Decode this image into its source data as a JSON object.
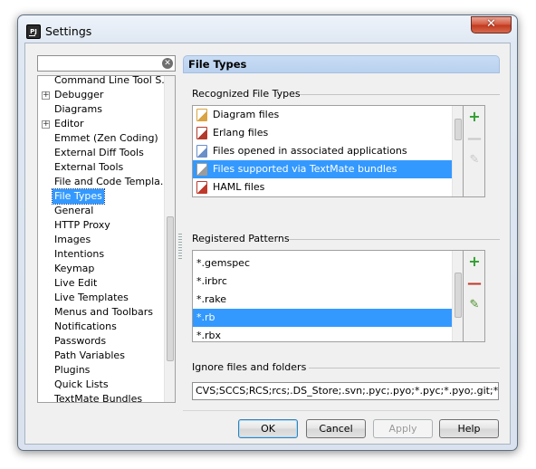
{
  "window": {
    "title": "Settings",
    "app_icon_text": "PJ",
    "close_glyph": "✕"
  },
  "sidebar": {
    "search": {
      "value": "",
      "clear_glyph": "✕"
    },
    "items": [
      {
        "label": "Command Line Tool S...",
        "expandable": false
      },
      {
        "label": "Debugger",
        "expandable": true
      },
      {
        "label": "Diagrams",
        "expandable": false
      },
      {
        "label": "Editor",
        "expandable": true
      },
      {
        "label": "Emmet (Zen Coding)",
        "expandable": false
      },
      {
        "label": "External Diff Tools",
        "expandable": false
      },
      {
        "label": "External Tools",
        "expandable": false
      },
      {
        "label": "File and Code Templa...",
        "expandable": false
      },
      {
        "label": "File Types",
        "expandable": false,
        "selected": true
      },
      {
        "label": "General",
        "expandable": false
      },
      {
        "label": "HTTP Proxy",
        "expandable": false
      },
      {
        "label": "Images",
        "expandable": false
      },
      {
        "label": "Intentions",
        "expandable": false
      },
      {
        "label": "Keymap",
        "expandable": false
      },
      {
        "label": "Live Edit",
        "expandable": false
      },
      {
        "label": "Live Templates",
        "expandable": false
      },
      {
        "label": "Menus and Toolbars",
        "expandable": false
      },
      {
        "label": "Notifications",
        "expandable": false
      },
      {
        "label": "Passwords",
        "expandable": false
      },
      {
        "label": "Path Variables",
        "expandable": false
      },
      {
        "label": "Plugins",
        "expandable": false
      },
      {
        "label": "Quick Lists",
        "expandable": false
      },
      {
        "label": "TextMate Bundles",
        "expandable": false
      }
    ],
    "expander_glyph": "+"
  },
  "main": {
    "header": "File Types",
    "recognized": {
      "label": "Recognized File Types",
      "items": [
        {
          "label": "Diagram files",
          "icon": "diagram-file-icon",
          "icon_color": "#d9a441"
        },
        {
          "label": "Erlang files",
          "icon": "erlang-file-icon",
          "icon_color": "#b33a2d"
        },
        {
          "label": "Files opened in associated applications",
          "icon": "external-file-icon",
          "icon_color": "#6a8fc9"
        },
        {
          "label": "Files supported via TextMate bundles",
          "icon": "textmate-file-icon",
          "icon_color": "#9b9b9b",
          "selected": true
        },
        {
          "label": "HAML files",
          "icon": "haml-file-icon",
          "icon_color": "#c0392b"
        }
      ]
    },
    "patterns": {
      "label": "Registered Patterns",
      "items": [
        {
          "label": "*.gemspec"
        },
        {
          "label": "*.irbrc"
        },
        {
          "label": "*.rake"
        },
        {
          "label": "*.rb",
          "selected": true
        },
        {
          "label": "*.rbx"
        }
      ]
    },
    "ignore": {
      "label": "Ignore files and folders",
      "value": "CVS;SCCS;RCS;rcs;.DS_Store;.svn;.pyc;.pyo;*.pyc;*.pyo;.git;*.h"
    },
    "tools": {
      "add": "+",
      "remove": "—",
      "edit": "✎"
    },
    "colors": {
      "add": "#2e9e2e",
      "remove_enabled": "#c0392b",
      "disabled": "#c8c8c8",
      "edit": "#4a8f2a"
    }
  },
  "footer": {
    "ok": "OK",
    "cancel": "Cancel",
    "apply": "Apply",
    "help": "Help"
  }
}
